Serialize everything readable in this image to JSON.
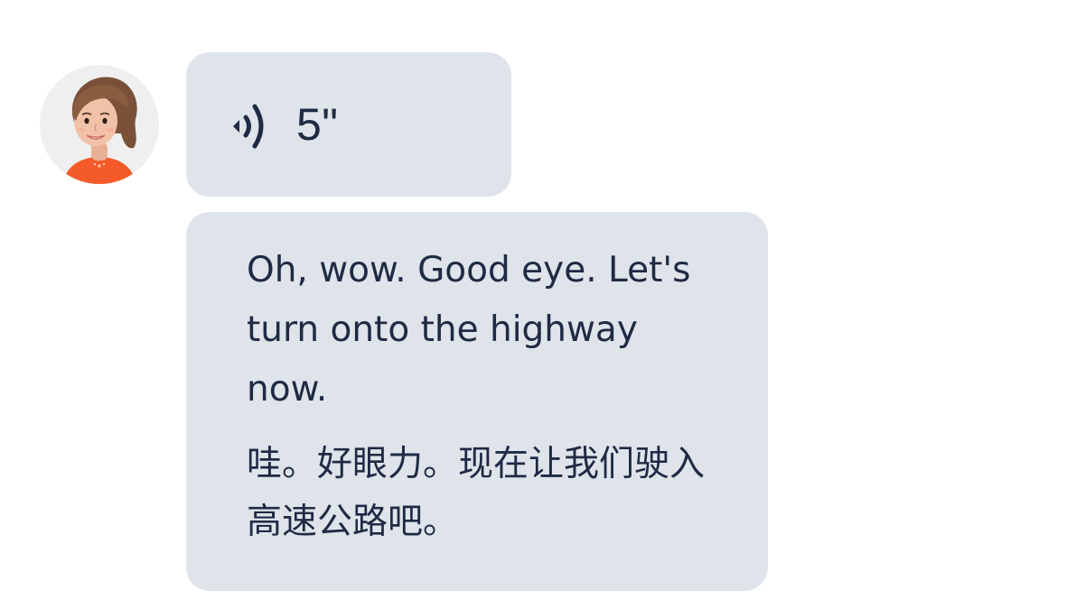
{
  "avatar": {
    "icon": "woman-avatar-icon",
    "shirt_color": "#f45a2a",
    "hair_color": "#7a5138",
    "skin_color": "#f2c2a8"
  },
  "voice_message": {
    "icon": "audio-waves-icon",
    "duration": "5\""
  },
  "text_message": {
    "english": "Oh, wow. Good eye. Let's turn onto the highway now.",
    "chinese": "哇。好眼力。现在让我们驶入高速公路吧。"
  },
  "colors": {
    "bubble_background": "#dfe3ea",
    "text": "#1f2a44",
    "page_background": "#ffffff"
  }
}
